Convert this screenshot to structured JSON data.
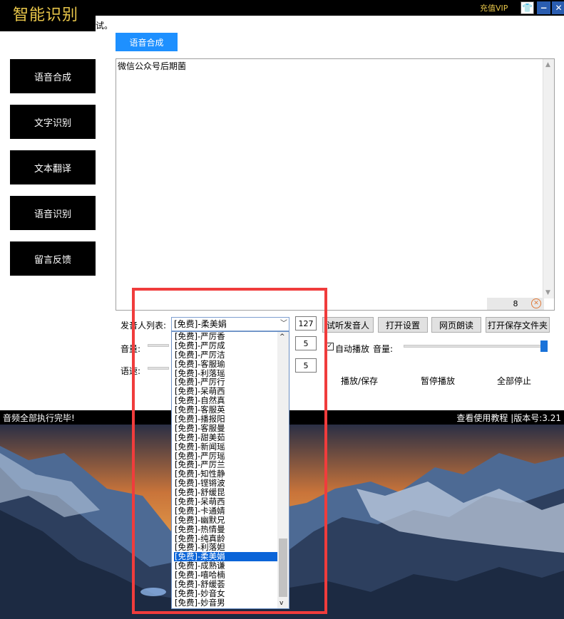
{
  "app": {
    "title": "智能识别",
    "vip": "充值VIP",
    "truncated_text": "试。"
  },
  "sidebar": {
    "items": [
      "语音合成",
      "文字识别",
      "文本翻译",
      "语音识别",
      "留言反馈"
    ]
  },
  "tab": {
    "label": "语音合成"
  },
  "editor": {
    "text": "微信公众号后期菌",
    "char_count": "8"
  },
  "controls": {
    "speaker_label": "发音人列表:",
    "speaker_selected": "[免费]-柔美娟",
    "speaker_count": "127",
    "volume_label": "音量:",
    "volume_value": "5",
    "speed_label": "语速:",
    "speed_value": "5",
    "audition_button": "试听发音人",
    "settings_button": "打开设置",
    "web_read_button": "网页朗读",
    "open_folder_button": "打开保存文件夹",
    "autoplay_label": "自动播放",
    "autoplay_checked": true,
    "player_volume_label": "音量:",
    "player_volume_level": 1.0,
    "play_save_button": "播放/保存",
    "pause_button": "暂停播放",
    "stop_all_button": "全部停止"
  },
  "status": {
    "left": "音频全部执行完毕!",
    "right": "查看使用教程 |版本号:3.21"
  },
  "dropdown": {
    "items": [
      "[免费]-严厉香",
      "[免费]-严厉成",
      "[免费]-严厉洁",
      "[免费]-客服瑜",
      "[免费]-利落瑶",
      "[免费]-严厉行",
      "[免费]-呆萌西",
      "[免费]-自然真",
      "[免费]-客服英",
      "[免费]-播报阳",
      "[免费]-客服曼",
      "[免费]-甜美茹",
      "[免费]-新闻瑶",
      "[免费]-严厉瑶",
      "[免费]-严厉兰",
      "[免费]-知性静",
      "[免费]-铿锵波",
      "[免费]-舒缓昆",
      "[免费]-呆萌西",
      "[免费]-卡通婧",
      "[免费]-幽默兄",
      "[免费]-热情曼",
      "[免费]-纯真龄",
      "[免费]-利落妲",
      "[免费]-柔美娟",
      "[免费]-成熟谦",
      "[免费]-嘻哈楠",
      "[免费]-舒缓荟",
      "[免费]-妙音女",
      "[免费]-妙音男"
    ],
    "selected_index": 24
  },
  "colors": {
    "accent": "#1e90ff",
    "title_gold": "#e8c64a",
    "highlight": "#f03c3c"
  }
}
